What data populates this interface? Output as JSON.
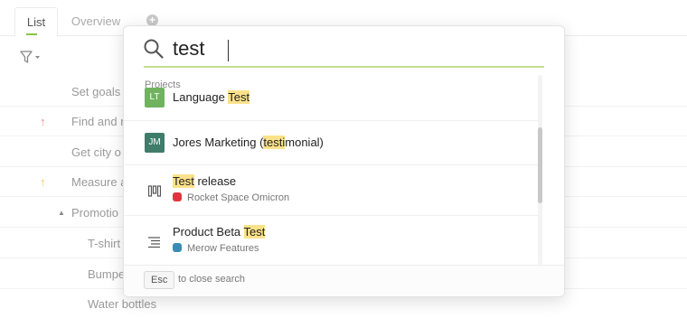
{
  "tabs": [
    {
      "label": "List"
    },
    {
      "label": "Overview"
    }
  ],
  "background_rows": [
    {
      "text": "Set goals",
      "arrow": ""
    },
    {
      "text": "Find and r",
      "arrow": "↑"
    },
    {
      "text": "Get city o",
      "arrow": ""
    },
    {
      "text": "Measure a",
      "arrow": "↑"
    },
    {
      "text": "Promotio",
      "arrow": ""
    },
    {
      "text": "T-shirt",
      "arrow": ""
    },
    {
      "text": "Bumpe",
      "arrow": ""
    },
    {
      "text": "Water bottles",
      "arrow": ""
    }
  ],
  "search": {
    "query": "test",
    "section_label": "Projects"
  },
  "results": [
    {
      "avatar": "LT",
      "avatar_color": "#6fb35f",
      "pre": "Language ",
      "hit": "Test",
      "post": "",
      "sub": ""
    },
    {
      "avatar": "JM",
      "avatar_color": "#3f7c69",
      "pre": "Jores Marketing (",
      "hit": "testi",
      "post": "monial)",
      "sub": ""
    },
    {
      "icon": "board-icon",
      "pre": "",
      "hit": "Test",
      "post": " release",
      "sub": "Rocket Space Omicron",
      "sub_color": "#e0353f"
    },
    {
      "icon": "list-icon",
      "pre": "Product Beta ",
      "hit": "Test",
      "post": "",
      "sub": "Merow Features",
      "sub_color": "#3a8bb5"
    }
  ],
  "footer": {
    "key": "Esc",
    "hint": "to close search"
  },
  "colors": {
    "accent": "#8bc34a",
    "highlight": "#fbe28a",
    "up_arrow_red": "#f28b82",
    "up_arrow_yellow": "#f5c542"
  }
}
